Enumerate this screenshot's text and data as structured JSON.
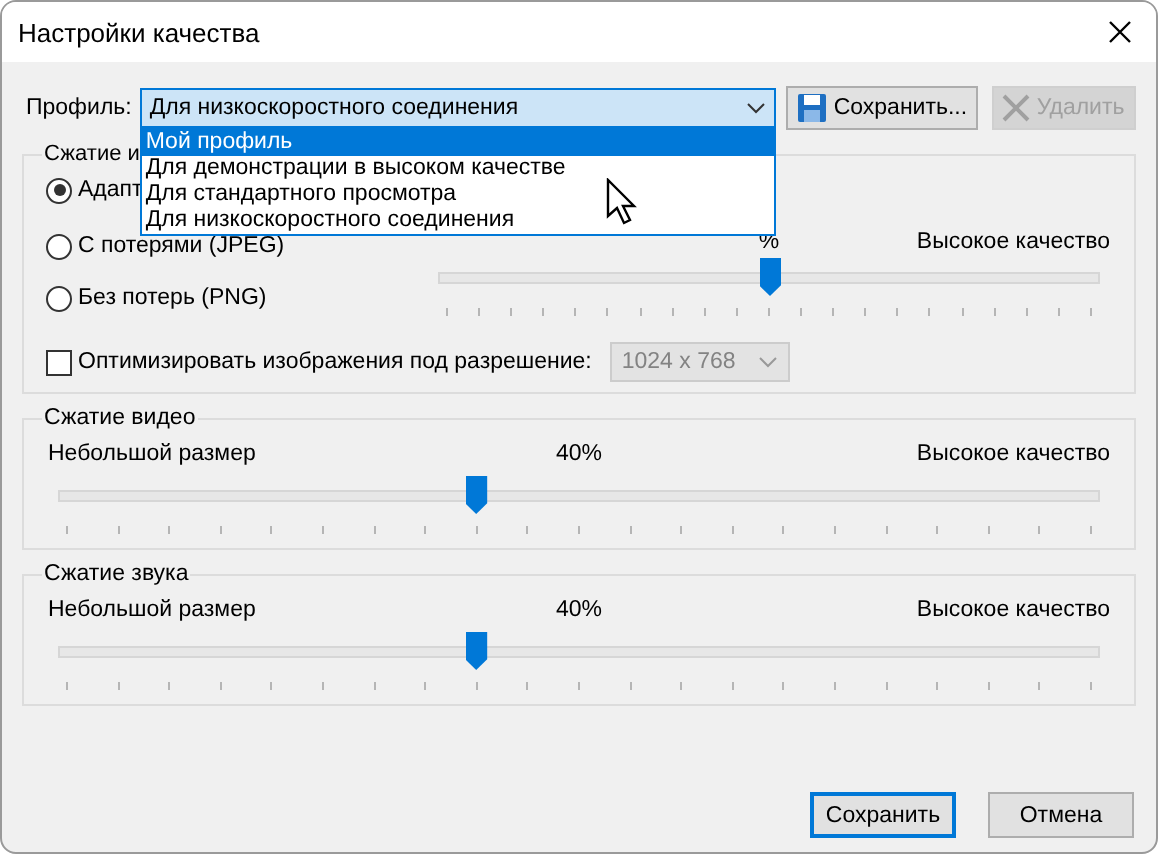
{
  "window": {
    "title": "Настройки качества"
  },
  "profile": {
    "label": "Профиль:",
    "value": "Для низкоскоростного соединения",
    "save": "Сохранить...",
    "delete": "Удалить",
    "delete_disabled": true,
    "options": [
      {
        "label": "Мой профиль",
        "highlighted": true
      },
      {
        "label": "Для демонстрации в высоком качестве",
        "highlighted": false
      },
      {
        "label": "Для стандартного просмотра",
        "highlighted": false
      },
      {
        "label": "Для низкоскоростного соединения",
        "highlighted": false
      }
    ]
  },
  "image": {
    "title": "Сжатие и",
    "modes": [
      {
        "label": "Адапт",
        "selected": true
      },
      {
        "label": "С потерями (JPEG)",
        "selected": false
      },
      {
        "label": "Без потерь (PNG)",
        "selected": false
      }
    ],
    "reading": "%",
    "high": "Высокое качество",
    "level": 0.5,
    "optimize": {
      "label": "Оптимизировать изображения под разрешение:",
      "checked": false,
      "resolution": "1024 x 768",
      "disabled": true
    }
  },
  "video": {
    "title": "Сжатие видео",
    "low": "Небольшой размер",
    "reading": "40%",
    "high": "Высокое качество",
    "level": 0.4
  },
  "audio": {
    "title": "Сжатие звука",
    "low": "Небольшой размер",
    "reading": "40%",
    "high": "Высокое качество",
    "level": 0.4
  },
  "buttons": [
    {
      "label": "Сохранить",
      "default": true
    },
    {
      "label": "Отмена",
      "default": false
    }
  ]
}
